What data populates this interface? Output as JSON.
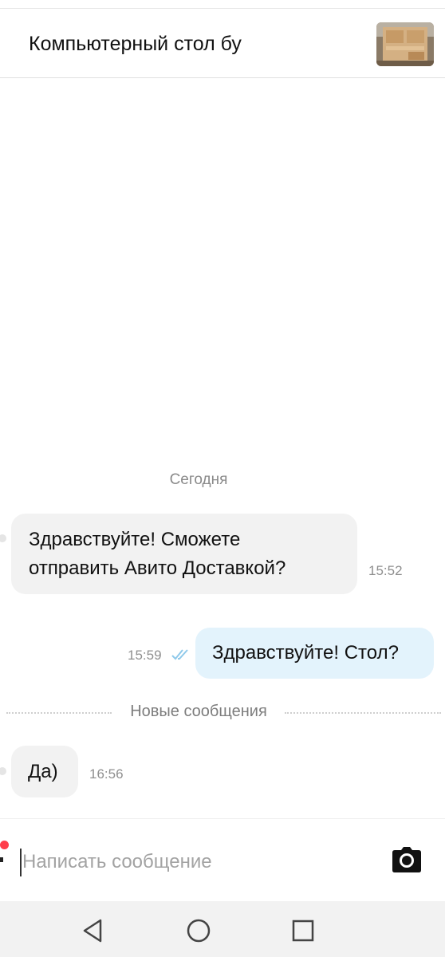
{
  "header": {
    "title": "Компьютерный стол бу",
    "thumbnail_icon": "desk-photo"
  },
  "chat": {
    "date_separator": "Сегодня",
    "messages": [
      {
        "direction": "incoming",
        "text_lines": [
          "Здравствуйте! Сможете",
          "отправить Авито Доставкой?"
        ],
        "time": "15:52"
      },
      {
        "direction": "outgoing",
        "text_lines": [
          "Здравствуйте! Стол?"
        ],
        "time": "15:59",
        "status_icon": "double-check-icon",
        "status_color": "#8fc9ea"
      },
      {
        "direction": "incoming",
        "text_lines": [
          "Да)"
        ],
        "time": "16:56"
      }
    ],
    "new_messages_separator": "Новые сообщения"
  },
  "composer": {
    "placeholder": "Написать сообщение",
    "value": "",
    "camera_icon": "camera-icon",
    "notification_dot_color": "#ff3d4a"
  },
  "navbar": {
    "icons": [
      "back-icon",
      "home-icon",
      "recents-icon"
    ]
  },
  "colors": {
    "incoming_bubble": "#f2f2f2",
    "outgoing_bubble": "#e3f3fc",
    "timestamp": "#8f8f8f"
  }
}
